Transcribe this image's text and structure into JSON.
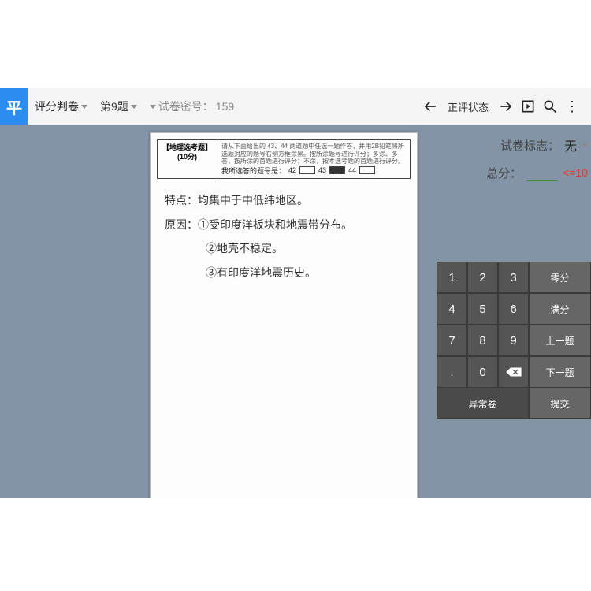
{
  "header": {
    "logo": "平",
    "mode": "评分判卷",
    "question": "第9题",
    "paper_id_label": "试卷密号：",
    "paper_id": "159",
    "status": "正评状态"
  },
  "paper": {
    "subject_line1": "【地理选考题】",
    "subject_line2": "(10分)",
    "instr_top": "请从下面给出的 43、44 两道题中任选一题作答，并用2B铅笔将所选题对应的题号右侧方框涂黑。按所涂题号进行评分；多涂、多答，按所涂的首题进行评分；不涂，按本选考题的首题进行评分。",
    "choice_label": "我所选答的题号是：",
    "choice_42": "42",
    "choice_43": "43",
    "choice_44": "44",
    "hw1_label": "特点：",
    "hw1_text": "均集中于中低纬地区。",
    "hw2_label": "原因：",
    "hw2_a": "①受印度洋板块和地震带分布。",
    "hw2_b": "②地壳不稳定。",
    "hw2_c": "③有印度洋地震历史。"
  },
  "side": {
    "mark_label": "试卷标志：",
    "mark_value": "无",
    "total_label": "总分：",
    "score_value": "",
    "max": "<=10"
  },
  "keypad": {
    "k1": "1",
    "k2": "2",
    "k3": "3",
    "zero": "零分",
    "k4": "4",
    "k5": "5",
    "k6": "6",
    "full": "满分",
    "k7": "7",
    "k8": "8",
    "k9": "9",
    "prev": "上一题",
    "dot": ".",
    "k0": "0",
    "next": "下一题",
    "abn": "异常卷",
    "submit": "提交"
  }
}
